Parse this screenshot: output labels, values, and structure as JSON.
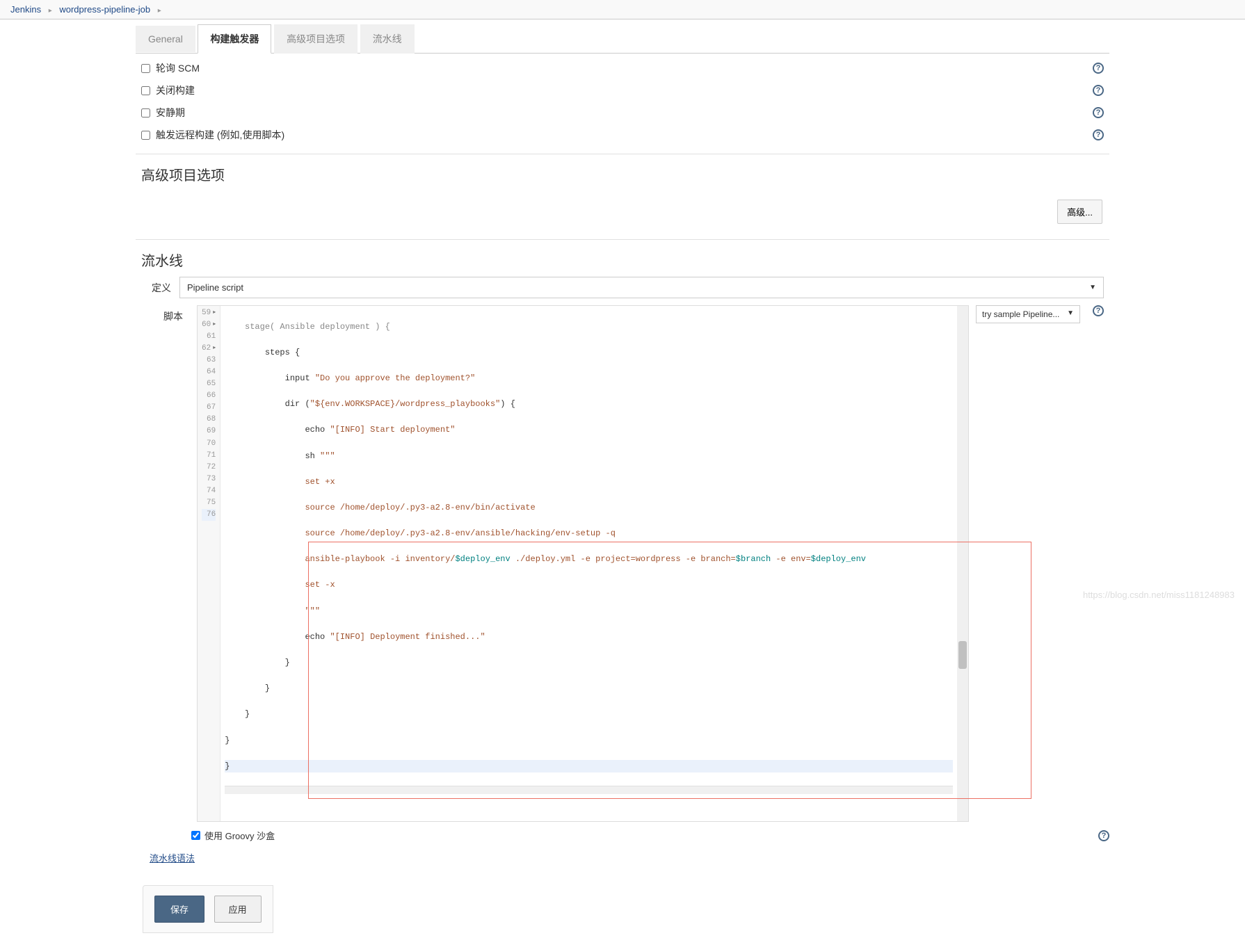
{
  "breadcrumb": {
    "root": "Jenkins",
    "job": "wordpress-pipeline-job"
  },
  "tabs": {
    "general": "General",
    "triggers": "构建触发器",
    "advanced": "高级项目选项",
    "pipeline": "流水线"
  },
  "triggers": {
    "poll_scm": "轮询 SCM",
    "disable_build": "关闭构建",
    "quiet_period": "安静期",
    "remote_trigger": "触发远程构建 (例如,使用脚本)"
  },
  "section_advanced": "高级项目选项",
  "btn_advanced": "高级...",
  "section_pipeline": "流水线",
  "form": {
    "definition_label": "定义",
    "definition_value": "Pipeline script",
    "script_label": "脚本",
    "sample_label": "try sample Pipeline...",
    "sandbox_label": "使用 Groovy 沙盒",
    "syntax_link": "流水线语法"
  },
  "code": {
    "ln59": "    stage( Ansible deployment ) {",
    "ln60": "        steps {",
    "ln61_a": "            input ",
    "ln61_b": "\"Do you approve the deployment?\"",
    "ln62_a": "            dir (",
    "ln62_b": "\"${env.WORKSPACE}/wordpress_playbooks\"",
    "ln62_c": ") {",
    "ln63_a": "                echo ",
    "ln63_b": "\"[INFO] Start deployment\"",
    "ln64_a": "                sh ",
    "ln64_b": "\"\"\"",
    "ln65": "                set +x",
    "ln66": "                source /home/deploy/.py3-a2.8-env/bin/activate",
    "ln67": "                source /home/deploy/.py3-a2.8-env/ansible/hacking/env-setup -q",
    "ln68_a": "                ansible-playbook -i inventory/",
    "ln68_b": "$deploy_env",
    "ln68_c": " ./deploy.yml -e project=wordpress -e branch=",
    "ln68_d": "$branch",
    "ln68_e": " -e env=",
    "ln68_f": "$deploy_env",
    "ln69": "                set -x",
    "ln70": "                \"\"\"",
    "ln71_a": "                echo ",
    "ln71_b": "\"[INFO] Deployment finished...\"",
    "ln72": "            }",
    "ln73": "        }",
    "ln74": "    }",
    "ln75": "}",
    "ln76": "}"
  },
  "buttons": {
    "save": "保存",
    "apply": "应用"
  },
  "watermark": "https://blog.csdn.net/miss1181248983"
}
